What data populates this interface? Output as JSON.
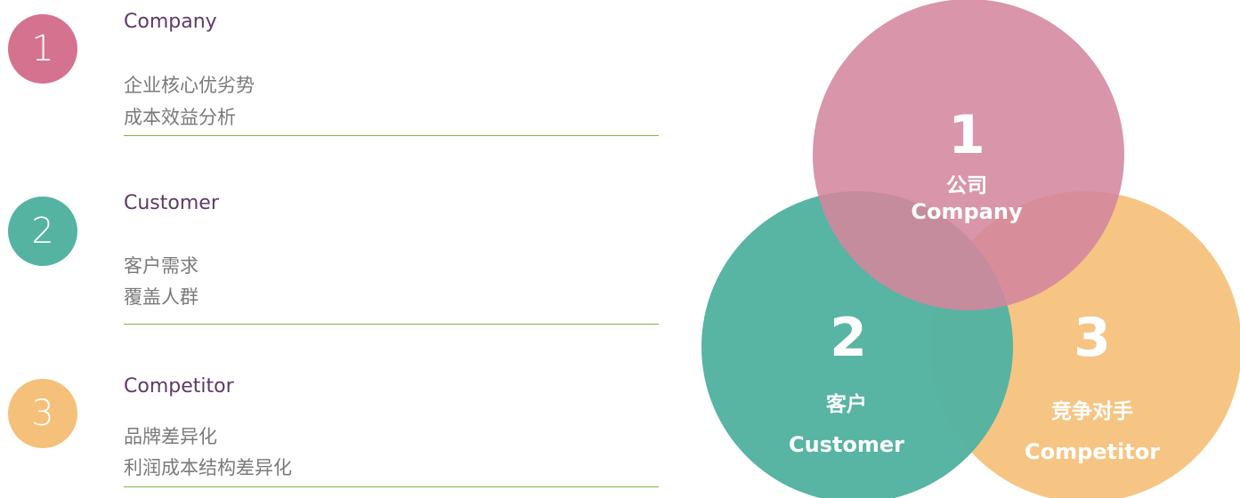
{
  "items": [
    {
      "number": "1",
      "title": "Company",
      "lines": [
        "企业核心优劣势",
        "成本效益分析"
      ],
      "color": "#d4728f"
    },
    {
      "number": "2",
      "title": "Customer",
      "lines": [
        "客户需求",
        "覆盖人群"
      ],
      "color": "#55b3a1"
    },
    {
      "number": "3",
      "title": "Competitor",
      "lines": [
        "品牌差异化",
        "利润成本结构差异化"
      ],
      "color": "#f5c07a"
    }
  ],
  "venn": {
    "company": {
      "number": "1",
      "cn": "公司",
      "en": "Company",
      "color": "#d4869d"
    },
    "customer": {
      "number": "2",
      "cn": "客户",
      "en": "Customer",
      "color": "#55b3a1"
    },
    "competitor": {
      "number": "3",
      "cn": "竞争对手",
      "en": "Competitor",
      "color": "#f5c07a"
    }
  }
}
